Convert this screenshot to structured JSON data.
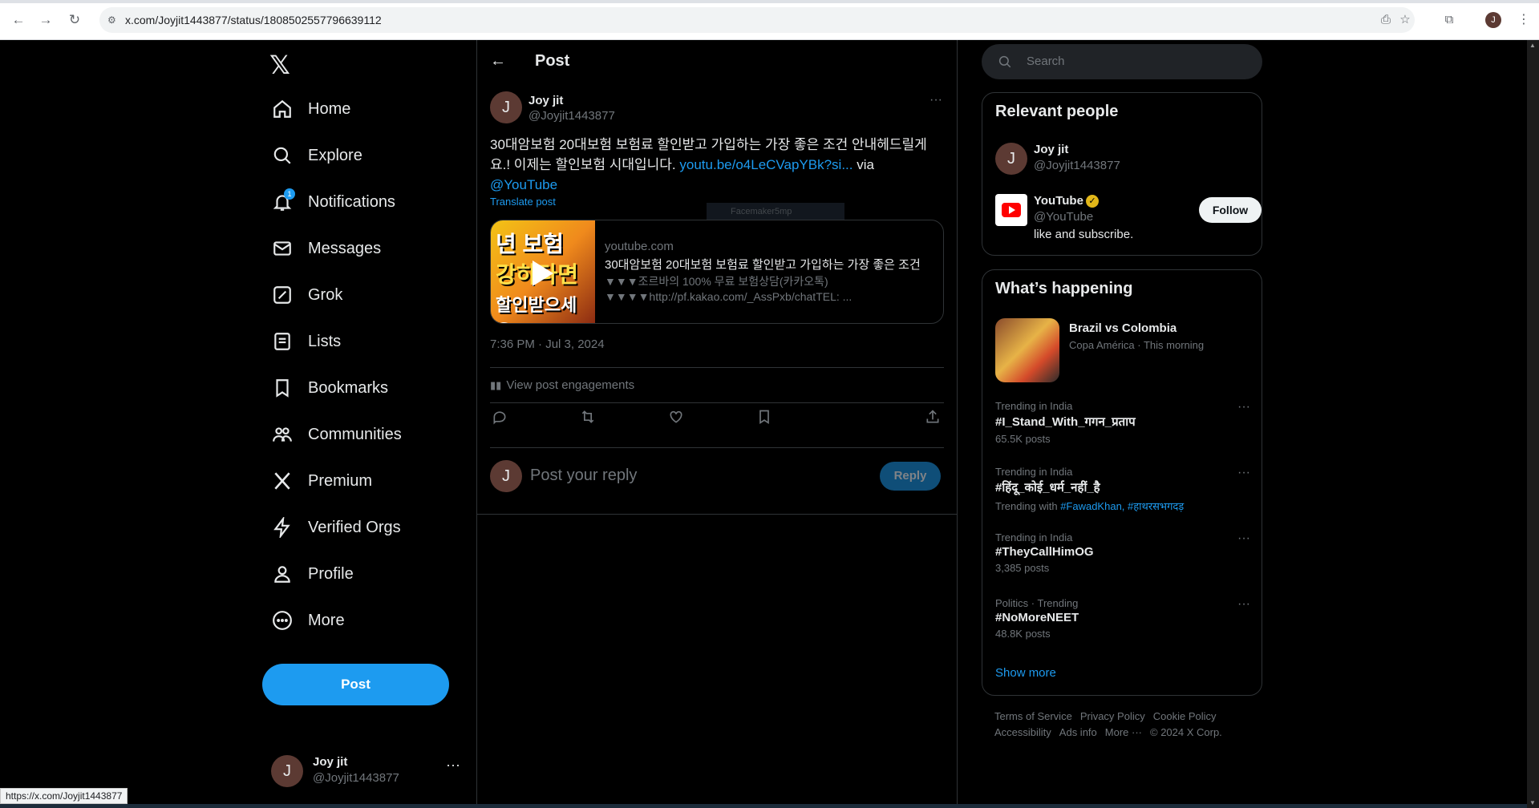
{
  "browser": {
    "url": "x.com/Joyjit1443877/status/1808502557796639112",
    "profile_initial": "J"
  },
  "status_bar": {
    "text": "https://x.com/Joyjit1443877"
  },
  "nav": {
    "items": [
      {
        "label": "Home",
        "icon": "home-icon"
      },
      {
        "label": "Explore",
        "icon": "search-icon"
      },
      {
        "label": "Notifications",
        "icon": "bell-icon",
        "badge": "1"
      },
      {
        "label": "Messages",
        "icon": "mail-icon"
      },
      {
        "label": "Grok",
        "icon": "grok-icon"
      },
      {
        "label": "Lists",
        "icon": "list-icon"
      },
      {
        "label": "Bookmarks",
        "icon": "bookmark-icon"
      },
      {
        "label": "Communities",
        "icon": "communities-icon"
      },
      {
        "label": "Premium",
        "icon": "x-logo-icon"
      },
      {
        "label": "Verified Orgs",
        "icon": "lightning-icon"
      },
      {
        "label": "Profile",
        "icon": "person-icon"
      },
      {
        "label": "More",
        "icon": "more-circle-icon"
      }
    ],
    "post_label": "Post"
  },
  "account": {
    "initial": "J",
    "name": "Joy jit",
    "handle": "@Joyjit1443877"
  },
  "header": {
    "title": "Post"
  },
  "tweet": {
    "initial": "J",
    "name": "Joy jit",
    "handle": "@Joyjit1443877",
    "text_part1": "30대암보험 20대보험 보험료 할인받고 가입하는 가장 좋은 조건 안내헤드릴게요.! 이제는 할인보험 시대입니다. ",
    "link": "youtu.be/o4LeCVapYBk?si...",
    "text_via": " via ",
    "mention": "@YouTube",
    "translate": "Translate post",
    "tooltip": "Facemaker5mp",
    "card": {
      "thumb_line1": "년 보험",
      "thumb_line2": "강하다면",
      "thumb_line3": "할인받으세요!",
      "domain": "youtube.com",
      "title": "30대암보험 20대보험 보험료 할인받고 가입하는 가장 좋은 조건",
      "desc1": "▼▼▼조르바의 100% 무료 보험상담(카카오톡)",
      "desc2": "▼▼▼▼http://pf.kakao.com/_AssPxb/chatTEL: ..."
    },
    "timestamp": "7:36 PM · Jul 3, 2024",
    "engagements": "View post engagements"
  },
  "reply": {
    "initial": "J",
    "placeholder": "Post your reply",
    "button": "Reply"
  },
  "search": {
    "placeholder": "Search"
  },
  "relevant": {
    "title": "Relevant people",
    "people": [
      {
        "initial": "J",
        "name": "Joy jit",
        "handle": "@Joyjit1443877"
      },
      {
        "name": "YouTube",
        "handle": "@YouTube",
        "bio": "like and subscribe.",
        "follow": "Follow"
      }
    ]
  },
  "happening": {
    "title": "What’s happening",
    "featured": {
      "title": "Brazil vs Colombia",
      "meta": "Copa América · This morning"
    },
    "trends": [
      {
        "meta": "Trending in India",
        "name": "#I_Stand_With_गगन_प्रताप",
        "count": "65.5K posts"
      },
      {
        "meta": "Trending in India",
        "name": "#हिंदू_कोई_धर्म_नहीं_है",
        "with_label": "Trending with",
        "with_tags": "#FawadKhan, #हाथरसभगदड़"
      },
      {
        "meta": "Trending in India",
        "name": "#TheyCallHimOG",
        "count": "3,385 posts"
      },
      {
        "meta": "Politics · Trending",
        "name": "#NoMoreNEET",
        "count": "48.8K posts"
      }
    ],
    "show_more": "Show more"
  },
  "footer": {
    "links": [
      "Terms of Service",
      "Privacy Policy",
      "Cookie Policy",
      "Accessibility",
      "Ads info",
      "More ···",
      "© 2024 X Corp."
    ]
  }
}
